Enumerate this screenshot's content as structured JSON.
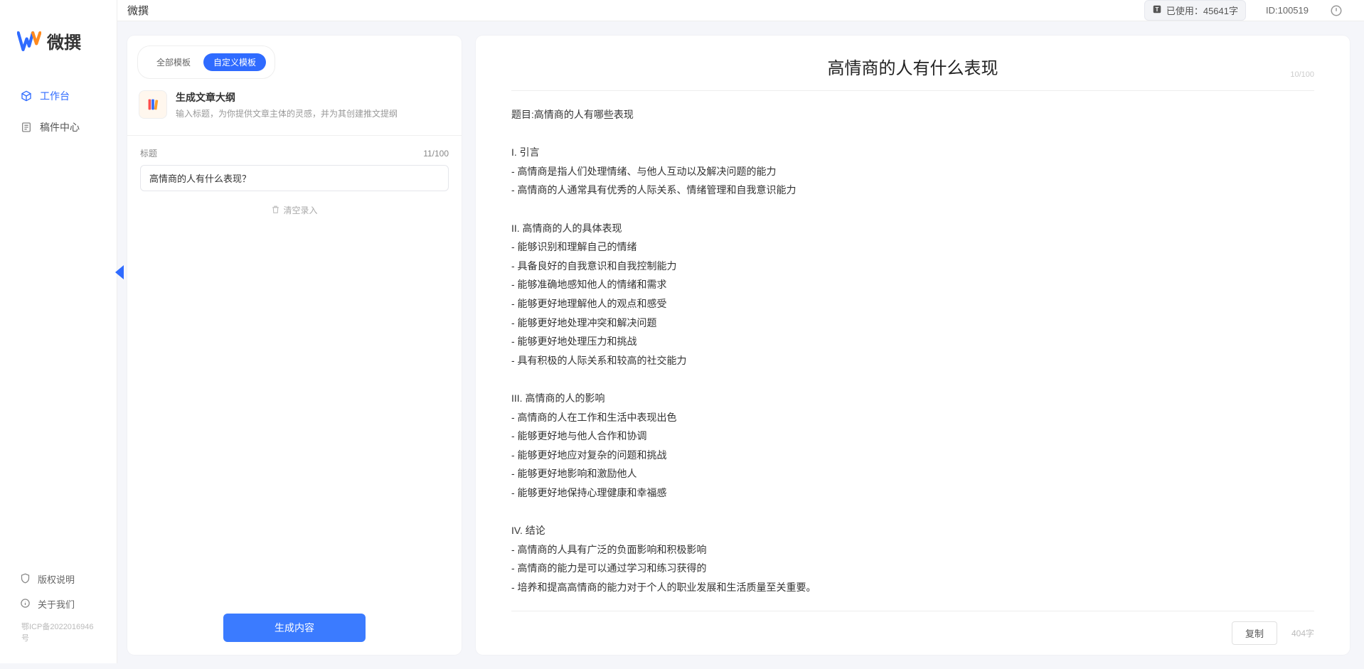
{
  "brand": {
    "name": "微撰"
  },
  "sidebar": {
    "nav": [
      {
        "label": "工作台",
        "active": true
      },
      {
        "label": "稿件中心",
        "active": false
      }
    ],
    "footer": [
      {
        "label": "版权说明"
      },
      {
        "label": "关于我们"
      }
    ],
    "icp": "鄂ICP备2022016946号"
  },
  "header": {
    "title": "微撰",
    "usage": "已使用：45641字",
    "user_id": "ID:100519"
  },
  "templates": {
    "tabs": [
      {
        "label": "全部模板",
        "active": false
      },
      {
        "label": "自定义模板",
        "active": true
      }
    ],
    "current": {
      "title": "生成文章大纲",
      "desc": "输入标题，为你提供文章主体的灵感，并为其创建推文提纲"
    }
  },
  "form": {
    "title_label": "标题",
    "title_counter": "11/100",
    "title_value": "高情商的人有什么表现？",
    "clear_label": "清空录入"
  },
  "actions": {
    "generate": "生成内容",
    "copy": "复制"
  },
  "output": {
    "title": "高情商的人有什么表现",
    "counter_top": "10/100",
    "word_count": "404字",
    "body": "题目:高情商的人有哪些表现\n\nI. 引言\n- 高情商是指人们处理情绪、与他人互动以及解决问题的能力\n- 高情商的人通常具有优秀的人际关系、情绪管理和自我意识能力\n\nII. 高情商的人的具体表现\n- 能够识别和理解自己的情绪\n- 具备良好的自我意识和自我控制能力\n- 能够准确地感知他人的情绪和需求\n- 能够更好地理解他人的观点和感受\n- 能够更好地处理冲突和解决问题\n- 能够更好地处理压力和挑战\n- 具有积极的人际关系和较高的社交能力\n\nIII. 高情商的人的影响\n- 高情商的人在工作和生活中表现出色\n- 能够更好地与他人合作和协调\n- 能够更好地应对复杂的问题和挑战\n- 能够更好地影响和激励他人\n- 能够更好地保持心理健康和幸福感\n\nIV. 结论\n- 高情商的人具有广泛的负面影响和积极影响\n- 高情商的能力是可以通过学习和练习获得的\n- 培养和提高高情商的能力对于个人的职业发展和生活质量至关重要。"
  }
}
